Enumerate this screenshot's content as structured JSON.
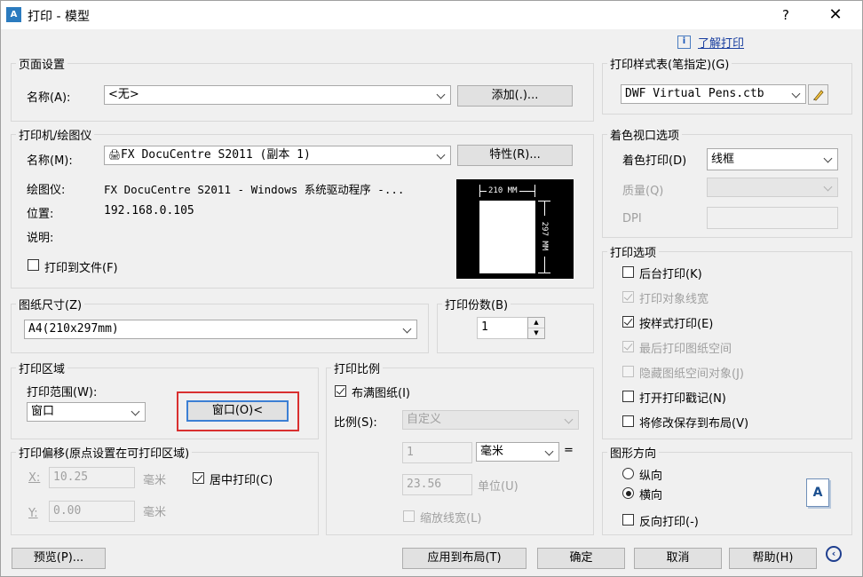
{
  "window": {
    "title": "打印 - 模型",
    "help": "?",
    "close": "✕",
    "app_icon": "A"
  },
  "help_link": "了解打印",
  "page_setup": {
    "title": "页面设置",
    "name_label": "名称(A):",
    "name_value": "<无>",
    "add_button": "添加(.)..."
  },
  "printer": {
    "title": "打印机/绘图仪",
    "name_label": "名称(M):",
    "name_value": "FX DocuCentre S2011 (副本 1)",
    "properties_button": "特性(R)...",
    "plotter_label": "绘图仪:",
    "plotter_value": "FX DocuCentre S2011 - Windows 系统驱动程序 -...",
    "location_label": "位置:",
    "location_value": "192.168.0.105",
    "desc_label": "说明:",
    "print_to_file": "打印到文件(F)",
    "preview_width": "210 MM",
    "preview_height": "297 MM"
  },
  "paper_size": {
    "title": "图纸尺寸(Z)",
    "value": "A4(210x297mm)"
  },
  "copies": {
    "title": "打印份数(B)",
    "value": "1"
  },
  "plot_area": {
    "title": "打印区域",
    "range_label": "打印范围(W):",
    "range_value": "窗口",
    "window_button": "窗口(O)<"
  },
  "plot_offset": {
    "title": "打印偏移(原点设置在可打印区域)",
    "x_label": "X:",
    "x_value": "10.25",
    "x_unit": "毫米",
    "center": "居中打印(C)",
    "y_label": "Y:",
    "y_value": "0.00",
    "y_unit": "毫米"
  },
  "plot_scale": {
    "title": "打印比例",
    "fit": "布满图纸(I)",
    "scale_label": "比例(S):",
    "scale_value": "自定义",
    "num1": "1",
    "unit_value": "毫米",
    "equals": "=",
    "num2": "23.56",
    "unit2": "单位(U)",
    "scale_lw": "缩放线宽(L)"
  },
  "style_table": {
    "title": "打印样式表(笔指定)(G)",
    "value": "DWF Virtual Pens.ctb"
  },
  "shaded": {
    "title": "着色视口选项",
    "shade_label": "着色打印(D)",
    "shade_value": "线框",
    "quality_label": "质量(Q)",
    "dpi_label": "DPI"
  },
  "options": {
    "title": "打印选项",
    "items": [
      "后台打印(K)",
      "打印对象线宽",
      "按样式打印(E)",
      "最后打印图纸空间",
      "隐藏图纸空间对象(J)",
      "打开打印戳记(N)",
      "将修改保存到布局(V)"
    ]
  },
  "orientation": {
    "title": "图形方向",
    "portrait": "纵向",
    "landscape": "横向",
    "reverse": "反向打印(-)"
  },
  "footer": {
    "preview": "预览(P)...",
    "apply": "应用到布局(T)",
    "ok": "确定",
    "cancel": "取消",
    "help": "帮助(H)"
  }
}
